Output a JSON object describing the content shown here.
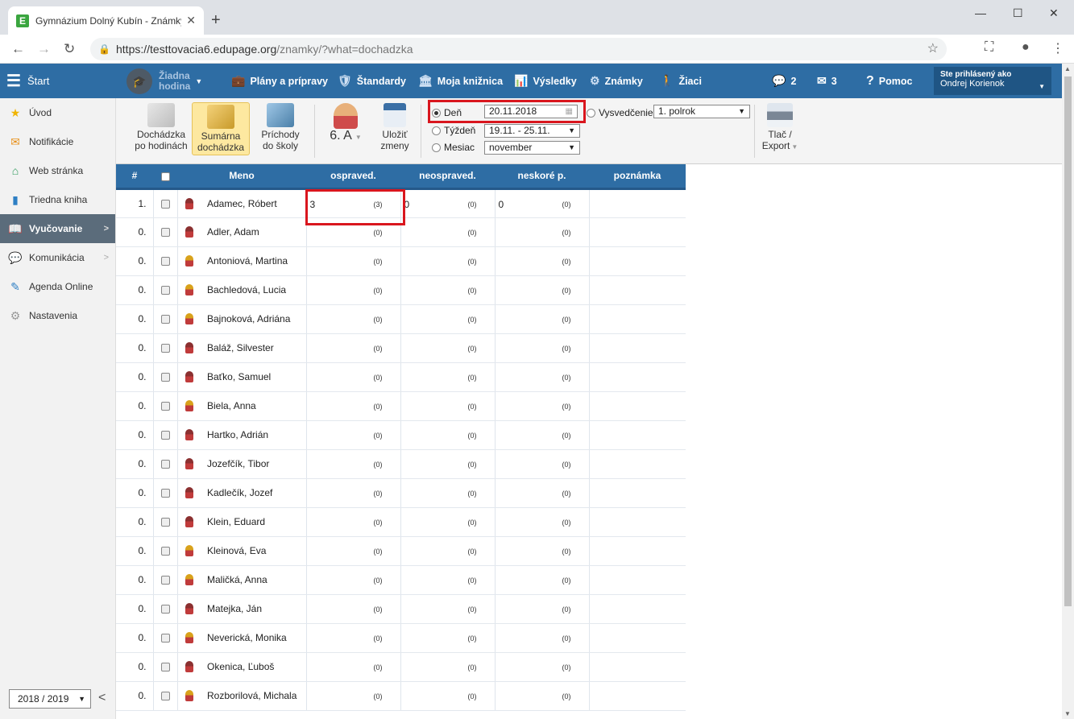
{
  "browser": {
    "tab_title": "Gymnázium Dolný Kubín - Známky",
    "favicon_letter": "E",
    "new_tab": "+",
    "url_host": "https://testtovacia6.edupage.org",
    "url_path": "/znamky/?what=dochadzka"
  },
  "header": {
    "start_label": "Štart",
    "lesson_label_1": "Žiadna",
    "lesson_label_2": "hodina",
    "nav": [
      "Plány a prípravy",
      "Štandardy",
      "Moja knižnica",
      "Výsledky",
      "Známky",
      "Žiaci"
    ],
    "messages_count": "2",
    "mail_count": "3",
    "help_label": "Pomoc",
    "user_label": "Ste prihlásený ako",
    "user_name": "Ondrej Korienok"
  },
  "sidebar": {
    "items": [
      {
        "label": "Úvod",
        "icon": "star-icon",
        "color": "#f0b400"
      },
      {
        "label": "Notifikácie",
        "icon": "envelope-icon",
        "color": "#e8901a"
      },
      {
        "label": "Web stránka",
        "icon": "house-icon",
        "color": "#2e9a5b"
      },
      {
        "label": "Triedna kniha",
        "icon": "book-icon",
        "color": "#2e7fc4"
      },
      {
        "label": "Vyučovanie",
        "icon": "open-book-icon",
        "color": "#ffffff"
      },
      {
        "label": "Komunikácia",
        "icon": "chat-icon",
        "color": "#c0392b"
      },
      {
        "label": "Agenda Online",
        "icon": "pen-icon",
        "color": "#2e7fc4"
      },
      {
        "label": "Nastavenia",
        "icon": "gear-icon",
        "color": "#999999"
      }
    ],
    "year": "2018 / 2019"
  },
  "toolbar": {
    "btn_hours": [
      "Dochádzka",
      "po hodinách"
    ],
    "btn_summary": [
      "Sumárna",
      "dochádzka"
    ],
    "btn_arrivals": [
      "Príchody",
      "do školy"
    ],
    "class_label": "6. A",
    "btn_save": [
      "Uložiť",
      "zmeny"
    ],
    "day_label": "Deň",
    "day_value": "20.11.2018",
    "week_label": "Týždeň",
    "week_value": "19.11. - 25.11.",
    "month_label": "Mesiac",
    "month_value": "november",
    "cert_label": "Vysvedčenie",
    "cert_value": "1. polrok",
    "print_label": [
      "Tlač /",
      "Export"
    ]
  },
  "table": {
    "headers": [
      "#",
      "",
      "Meno",
      "ospraved.",
      "neospraved.",
      "neskoré p.",
      "poznámka"
    ],
    "rows": [
      {
        "num": "1.",
        "gender": "m",
        "name": "Adamec, Róbert",
        "osp": "3",
        "osp_sub": "(3)",
        "neosp": "0",
        "neosp_sub": "(0)",
        "nesk": "0",
        "nesk_sub": "(0)"
      },
      {
        "num": "0.",
        "gender": "m",
        "name": "Adler, Adam",
        "osp": "",
        "osp_sub": "(0)",
        "neosp": "",
        "neosp_sub": "(0)",
        "nesk": "",
        "nesk_sub": "(0)"
      },
      {
        "num": "0.",
        "gender": "f",
        "name": "Antoniová, Martina",
        "osp": "",
        "osp_sub": "(0)",
        "neosp": "",
        "neosp_sub": "(0)",
        "nesk": "",
        "nesk_sub": "(0)"
      },
      {
        "num": "0.",
        "gender": "f",
        "name": "Bachledová, Lucia",
        "osp": "",
        "osp_sub": "(0)",
        "neosp": "",
        "neosp_sub": "(0)",
        "nesk": "",
        "nesk_sub": "(0)"
      },
      {
        "num": "0.",
        "gender": "f",
        "name": "Bajnoková, Adriána",
        "osp": "",
        "osp_sub": "(0)",
        "neosp": "",
        "neosp_sub": "(0)",
        "nesk": "",
        "nesk_sub": "(0)"
      },
      {
        "num": "0.",
        "gender": "m",
        "name": "Baláž, Silvester",
        "osp": "",
        "osp_sub": "(0)",
        "neosp": "",
        "neosp_sub": "(0)",
        "nesk": "",
        "nesk_sub": "(0)"
      },
      {
        "num": "0.",
        "gender": "m",
        "name": "Baťko, Samuel",
        "osp": "",
        "osp_sub": "(0)",
        "neosp": "",
        "neosp_sub": "(0)",
        "nesk": "",
        "nesk_sub": "(0)"
      },
      {
        "num": "0.",
        "gender": "f",
        "name": "Biela, Anna",
        "osp": "",
        "osp_sub": "(0)",
        "neosp": "",
        "neosp_sub": "(0)",
        "nesk": "",
        "nesk_sub": "(0)"
      },
      {
        "num": "0.",
        "gender": "m",
        "name": "Hartko, Adrián",
        "osp": "",
        "osp_sub": "(0)",
        "neosp": "",
        "neosp_sub": "(0)",
        "nesk": "",
        "nesk_sub": "(0)"
      },
      {
        "num": "0.",
        "gender": "m",
        "name": "Jozefčík, Tibor",
        "osp": "",
        "osp_sub": "(0)",
        "neosp": "",
        "neosp_sub": "(0)",
        "nesk": "",
        "nesk_sub": "(0)"
      },
      {
        "num": "0.",
        "gender": "m",
        "name": "Kadlečík, Jozef",
        "osp": "",
        "osp_sub": "(0)",
        "neosp": "",
        "neosp_sub": "(0)",
        "nesk": "",
        "nesk_sub": "(0)"
      },
      {
        "num": "0.",
        "gender": "m",
        "name": "Klein, Eduard",
        "osp": "",
        "osp_sub": "(0)",
        "neosp": "",
        "neosp_sub": "(0)",
        "nesk": "",
        "nesk_sub": "(0)"
      },
      {
        "num": "0.",
        "gender": "f",
        "name": "Kleinová, Eva",
        "osp": "",
        "osp_sub": "(0)",
        "neosp": "",
        "neosp_sub": "(0)",
        "nesk": "",
        "nesk_sub": "(0)"
      },
      {
        "num": "0.",
        "gender": "f",
        "name": "Maličká, Anna",
        "osp": "",
        "osp_sub": "(0)",
        "neosp": "",
        "neosp_sub": "(0)",
        "nesk": "",
        "nesk_sub": "(0)"
      },
      {
        "num": "0.",
        "gender": "m",
        "name": "Matejka, Ján",
        "osp": "",
        "osp_sub": "(0)",
        "neosp": "",
        "neosp_sub": "(0)",
        "nesk": "",
        "nesk_sub": "(0)"
      },
      {
        "num": "0.",
        "gender": "f",
        "name": "Neverická, Monika",
        "osp": "",
        "osp_sub": "(0)",
        "neosp": "",
        "neosp_sub": "(0)",
        "nesk": "",
        "nesk_sub": "(0)"
      },
      {
        "num": "0.",
        "gender": "m",
        "name": "Okenica, Ľuboš",
        "osp": "",
        "osp_sub": "(0)",
        "neosp": "",
        "neosp_sub": "(0)",
        "nesk": "",
        "nesk_sub": "(0)"
      },
      {
        "num": "0.",
        "gender": "f",
        "name": "Rozborilová, Michala",
        "osp": "",
        "osp_sub": "(0)",
        "neosp": "",
        "neosp_sub": "(0)",
        "nesk": "",
        "nesk_sub": "(0)"
      }
    ]
  }
}
